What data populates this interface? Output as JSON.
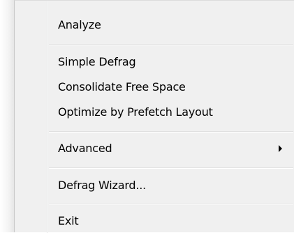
{
  "menu": {
    "items": [
      {
        "label": "Analyze"
      },
      {
        "label": "Simple Defrag"
      },
      {
        "label": "Consolidate Free Space"
      },
      {
        "label": "Optimize by Prefetch Layout"
      },
      {
        "label": "Advanced",
        "has_submenu": true
      },
      {
        "label": "Defrag Wizard..."
      },
      {
        "label": "Exit"
      }
    ],
    "submenu_arrow_icon": "submenu-arrow-icon"
  }
}
